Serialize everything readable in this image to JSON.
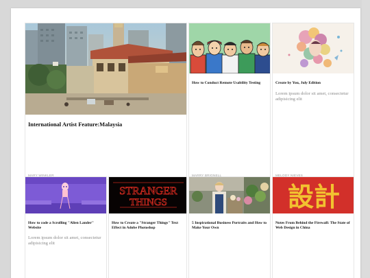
{
  "cards": [
    {
      "title": "International Artist Feature:Malaysia",
      "excerpt": "",
      "author": "MARY WINKLER",
      "image": "malaysia-street-painting-image"
    },
    {
      "title": "How to Conduct Remote Usability Testing",
      "excerpt": "",
      "author": "MARRY BRIGNELL",
      "image": "cartoon-people-crowd-image"
    },
    {
      "title": "Create by You, July Edition",
      "excerpt": "Lorem ipsum dolor sit amet, consectetur adipisicing elit",
      "author": "MELODY NIEVES",
      "image": "floral-portrait-illustration-image"
    },
    {
      "title": "How to code a Scrolling \"Alien Lander\" Website",
      "excerpt": "Lorem ipsum dolor sit amet, consectetur adipisicing elit",
      "author": "",
      "image": "alien-lander-image"
    },
    {
      "title": "How to Create a \"Stranger Things\" Text Effect in Adobe Photoshop",
      "excerpt": "",
      "author": "",
      "image": "stranger-things-logo-image"
    },
    {
      "title": "5 Inspirational Business Portraits and How to Make Your Own",
      "excerpt": "",
      "author": "",
      "image": "florist-portrait-image"
    },
    {
      "title": "Notes From Behind the Firewall: The State of Web Design in China",
      "excerpt": "",
      "author": "",
      "image": "chinese-characters-sign-image"
    }
  ],
  "images": {
    "stranger_text_1": "STRANGER",
    "stranger_text_2": "THINGS",
    "china_text": "設計"
  }
}
